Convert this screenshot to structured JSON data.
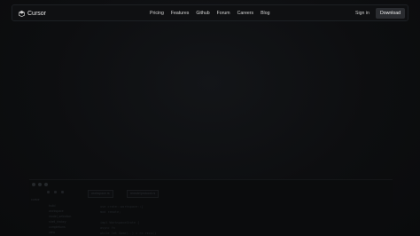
{
  "nav": {
    "brand": "Cursor",
    "links": [
      "Pricing",
      "Features",
      "Github",
      "Forum",
      "Careers",
      "Blog"
    ],
    "sign_in": "Sign in",
    "download": "Download"
  },
  "editor": {
    "tabs": [
      "workspace.rs",
      "remote/protocol.rs"
    ],
    "sidebar_label": "cursor",
    "sidebar_items": [
      "build",
      "workspace",
      "model_selection",
      "shell_history",
      "completions",
      "view"
    ],
    "code_lines": [
      "use crate::workspace::{",
      "  mod remote;",
      "",
      "impl WorkspaceState {",
      "  async fn",
      "    while let Some(..) = rx.recv()"
    ]
  },
  "colors": {
    "background": "#0c0d0e",
    "accent_button": "#2a2c30"
  }
}
